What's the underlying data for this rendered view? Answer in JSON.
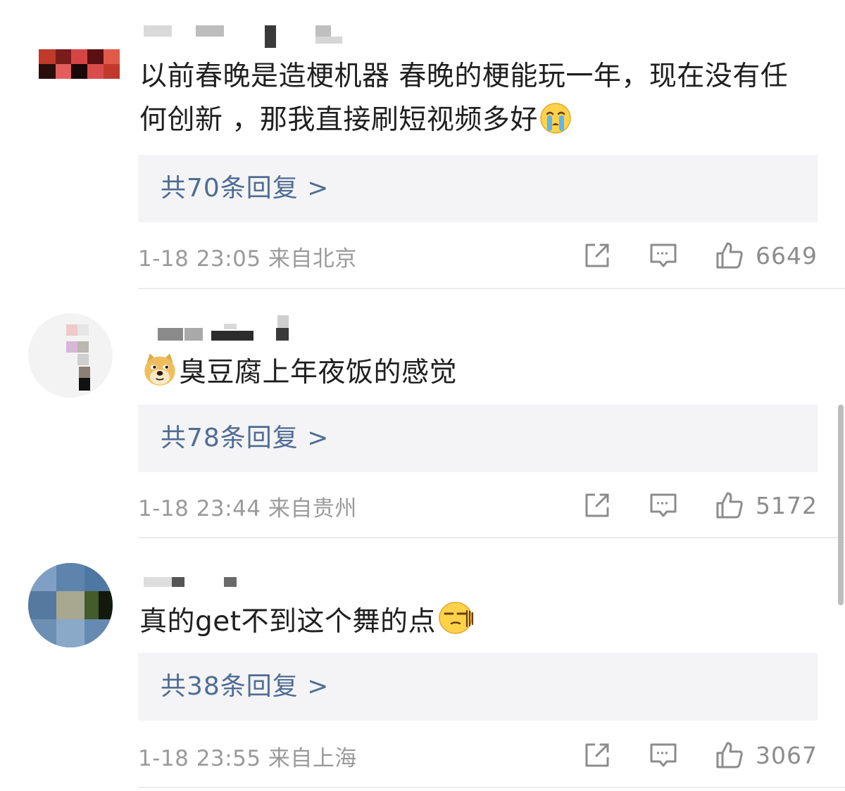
{
  "comments": [
    {
      "text_before_emoji": "以前春晚是造梗机器 春晚的梗能玩一年，现在没有任何创新 ，那我直接刷短视频多好",
      "text_after_emoji": "",
      "emoji_icon": "crying-face-icon",
      "replies_label": "共70条回复 >",
      "time": "1-18 23:05",
      "location": "来自北京",
      "likes": "6649"
    },
    {
      "text_before_emoji": "",
      "text_after_emoji": "臭豆腐上年夜饭的感觉",
      "emoji_icon": "doge-icon",
      "replies_label": "共78条回复 >",
      "time": "1-18 23:44",
      "location": "来自贵州",
      "likes": "5172"
    },
    {
      "text_before_emoji": "真的get不到这个舞的点",
      "text_after_emoji": "",
      "emoji_icon": "smirk-face-icon",
      "replies_label": "共38条回复 >",
      "time": "1-18 23:55",
      "location": "来自上海",
      "likes": "3067"
    }
  ],
  "icons": {
    "share": "share-icon",
    "reply": "comment-icon",
    "like": "thumbs-up-icon"
  },
  "colors": {
    "reply_link": "#4f6c93",
    "reply_box_bg": "#f4f4f6",
    "meta_text": "#9a9a9a",
    "icon_stroke": "#8c8c8c"
  }
}
